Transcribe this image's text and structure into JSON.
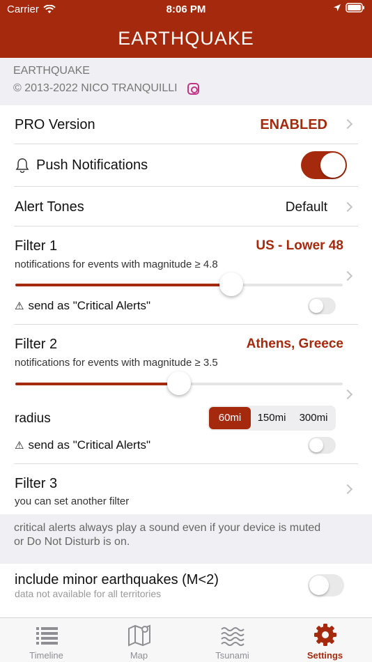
{
  "status_bar": {
    "carrier": "Carrier",
    "time": "8:06 PM"
  },
  "navbar": {
    "title": "EARTHQUAKE"
  },
  "header": {
    "app_name": "EARTHQUAKE",
    "copyright": "© 2013-2022 NICO TRANQUILLI"
  },
  "pro_version": {
    "label": "PRO Version",
    "value": "ENABLED"
  },
  "push_notifications": {
    "label": "Push Notifications",
    "enabled": true
  },
  "alert_tones": {
    "label": "Alert Tones",
    "value": "Default"
  },
  "filter1": {
    "title": "Filter 1",
    "location": "US - Lower 48",
    "description": "notifications for events with magnitude ≥ 4.8",
    "magnitude_fraction": 0.66,
    "critical_label": "send as \"Critical Alerts\"",
    "critical_enabled": false
  },
  "filter2": {
    "title": "Filter 2",
    "location": "Athens, Greece",
    "description": "notifications for events with magnitude ≥ 3.5",
    "magnitude_fraction": 0.5,
    "radius_label": "radius",
    "radius_options": [
      "60mi",
      "150mi",
      "300mi"
    ],
    "radius_selected": "60mi",
    "critical_label": "send as \"Critical Alerts\"",
    "critical_enabled": false
  },
  "filter3": {
    "title": "Filter 3",
    "subtitle": "you can set another filter"
  },
  "note": "critical alerts always play a sound even if your device is muted or Do Not Disturb is on.",
  "minor_quakes": {
    "label": "include minor earthquakes (M<2)",
    "subtitle": "data not available for all territories",
    "enabled": false
  },
  "tabs": [
    {
      "label": "Timeline",
      "icon": "list-icon"
    },
    {
      "label": "Map",
      "icon": "map-icon"
    },
    {
      "label": "Tsunami",
      "icon": "waves-icon"
    },
    {
      "label": "Settings",
      "icon": "gear-icon",
      "active": true
    }
  ],
  "colors": {
    "accent": "#a52a0d",
    "background": "#efeff4"
  }
}
